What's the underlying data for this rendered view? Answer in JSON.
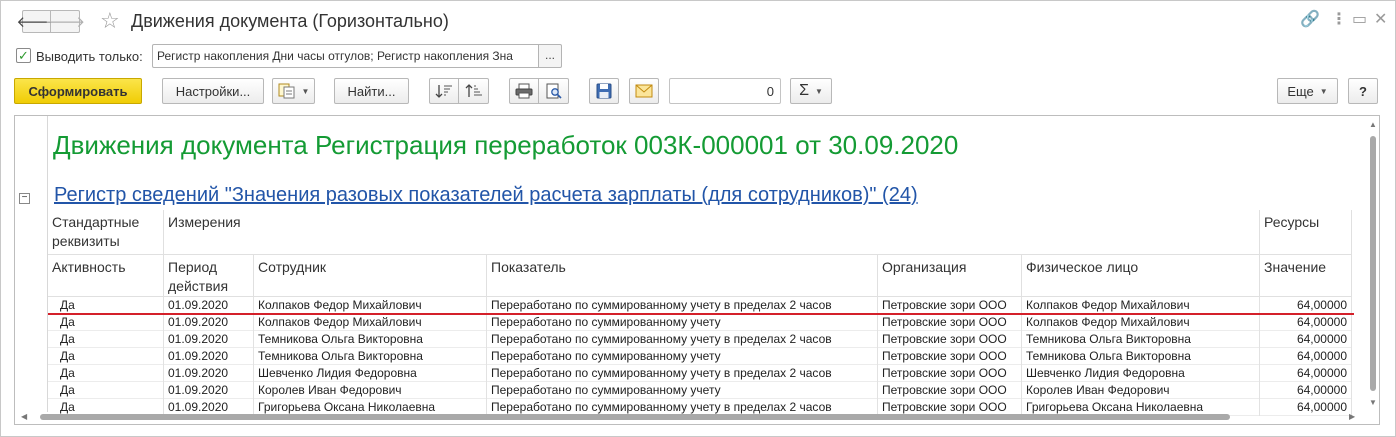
{
  "window": {
    "title": "Движения документа (Горизонтально)",
    "back_glyph": "🡐",
    "forward_glyph": "🡒",
    "star_glyph": "☆",
    "link_glyph": "🔗",
    "menu_glyph": "⋮",
    "maximize_glyph": "▭",
    "close_glyph": "✕"
  },
  "filter": {
    "checkbox_checked": true,
    "checkbox_mark": "✓",
    "label": "Выводить только:",
    "value": "Регистр накопления Дни часы отгулов; Регистр накопления Зна",
    "select_btn": "..."
  },
  "toolbar": {
    "generate": "Сформировать",
    "settings": "Настройки...",
    "find": "Найти...",
    "number_value": "0",
    "sigma": "Σ",
    "more": "Еще",
    "help": "?",
    "caret": "▼"
  },
  "report": {
    "title": "Движения документа Регистрация переработок 003К-000001 от 30.09.2020",
    "register_link": "Регистр сведений \"Значения разовых показателей расчета зарплаты (для сотрудников)\" (24)",
    "collapse_glyph": "−",
    "group_headers": {
      "standard": "Стандартные реквизиты",
      "dimensions": "Измерения",
      "resources": "Ресурсы"
    },
    "columns": [
      "Активность",
      "Период действия",
      "Сотрудник",
      "Показатель",
      "Организация",
      "Физическое лицо",
      "Значение"
    ],
    "rows": [
      [
        "Да",
        "01.09.2020",
        "Колпаков Федор Михайлович",
        "Переработано по суммированному учету в пределах 2 часов",
        "Петровские зори ООО",
        "Колпаков Федор Михайлович",
        "64,00000"
      ],
      [
        "Да",
        "01.09.2020",
        "Колпаков Федор Михайлович",
        "Переработано по суммированному учету",
        "Петровские зори ООО",
        "Колпаков Федор Михайлович",
        "64,00000"
      ],
      [
        "Да",
        "01.09.2020",
        "Темникова Ольга Викторовна",
        "Переработано по суммированному учету в пределах 2 часов",
        "Петровские зори ООО",
        "Темникова Ольга Викторовна",
        "64,00000"
      ],
      [
        "Да",
        "01.09.2020",
        "Темникова Ольга Викторовна",
        "Переработано по суммированному учету",
        "Петровские зори ООО",
        "Темникова Ольга Викторовна",
        "64,00000"
      ],
      [
        "Да",
        "01.09.2020",
        "Шевченко Лидия Федоровна",
        "Переработано по суммированному учету в пределах 2 часов",
        "Петровские зори ООО",
        "Шевченко Лидия Федоровна",
        "64,00000"
      ],
      [
        "Да",
        "01.09.2020",
        "Королев Иван Федорович",
        "Переработано по суммированному учету",
        "Петровские зори ООО",
        "Королев Иван Федорович",
        "64,00000"
      ],
      [
        "Да",
        "01.09.2020",
        "Григорьева Оксана Николаевна",
        "Переработано по суммированному учету в пределах 2 часов",
        "Петровские зори ООО",
        "Григорьева Оксана Николаевна",
        "64,00000"
      ]
    ]
  },
  "colors": {
    "title_green": "#149b34",
    "link_blue": "#2255a8",
    "highlight_red": "#d4202a",
    "primary_yellow": "#f0cd05"
  }
}
